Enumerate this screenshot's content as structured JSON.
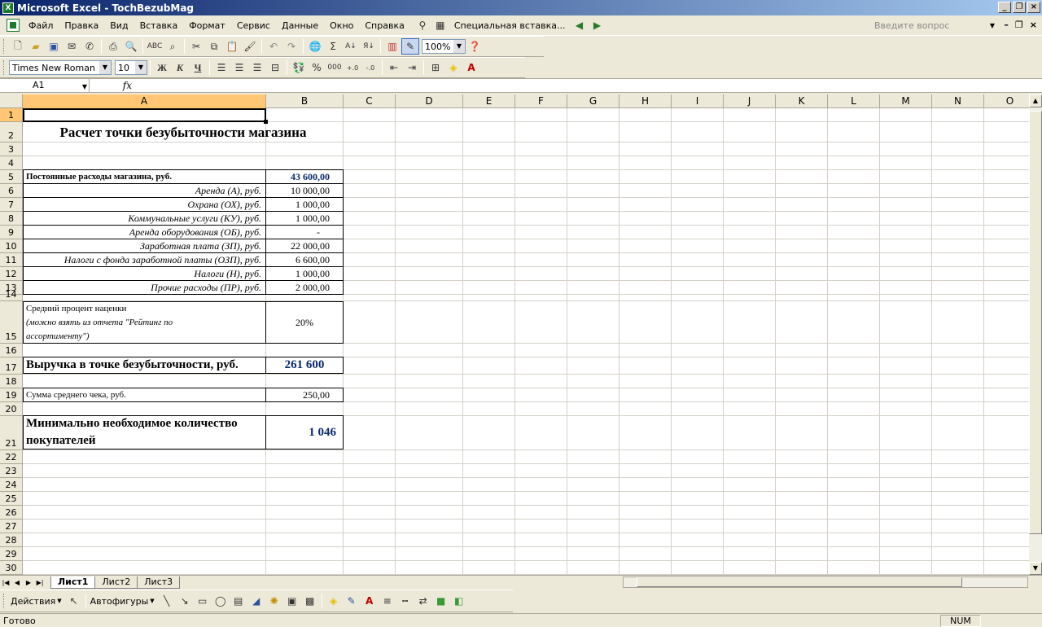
{
  "window": {
    "title": "Microsoft Excel - TochBezubMag"
  },
  "menu": {
    "items": [
      "Файл",
      "Правка",
      "Вид",
      "Вставка",
      "Формат",
      "Сервис",
      "Данные",
      "Окно",
      "Справка"
    ],
    "special_paste": "Специальная вставка...",
    "help_placeholder": "Введите вопрос"
  },
  "toolbar": {
    "zoom": "100%",
    "font_name": "Times New Roman",
    "font_size": "10",
    "bold": "Ж",
    "italic": "К",
    "underline": "Ч",
    "sum": "Σ",
    "percent": "%",
    "thousands": "000"
  },
  "formula_bar": {
    "name_box": "A1",
    "fx": "fx"
  },
  "columns": [
    "A",
    "B",
    "C",
    "D",
    "E",
    "F",
    "G",
    "H",
    "I",
    "J",
    "K",
    "L",
    "M",
    "N",
    "O"
  ],
  "rows": [
    "1",
    "2",
    "3",
    "4",
    "5",
    "6",
    "7",
    "8",
    "9",
    "10",
    "11",
    "12",
    "13",
    "14",
    "15",
    "16",
    "17",
    "18",
    "19",
    "20",
    "21",
    "22",
    "23",
    "24",
    "25",
    "26",
    "27",
    "28",
    "29",
    "30"
  ],
  "sheet": {
    "title": "Расчет точки безубыточности магазина",
    "fixed_costs_label": "Постоянные расходы магазина, руб.",
    "fixed_costs_value": "43 600,00",
    "cost_items": [
      {
        "label": "Аренда (А), руб.",
        "value": "10 000,00"
      },
      {
        "label": "Охрана (ОХ), руб.",
        "value": "1 000,00"
      },
      {
        "label": "Коммунальные услуги (КУ), руб.",
        "value": "1 000,00"
      },
      {
        "label": "Аренда оборудования (ОБ), руб.",
        "value": "-"
      },
      {
        "label": "Заработная плата (ЗП), руб.",
        "value": "22 000,00"
      },
      {
        "label": "Налоги с фонда заработной платы (ОЗП), руб.",
        "value": "6 600,00"
      },
      {
        "label": "Налоги (Н), руб.",
        "value": "1 000,00"
      },
      {
        "label": "Прочие расходы (ПР), руб.",
        "value": "2 000,00"
      }
    ],
    "markup_label_1": "Средний процент наценки",
    "markup_label_2": "(можно взять из отчета \"Рейтинг по",
    "markup_label_3": "ассортименту\")",
    "markup_value": "20%",
    "revenue_label": "Выручка в точке безубыточности, руб.",
    "revenue_value": "261 600",
    "avg_check_label": "Сумма среднего чека, руб.",
    "avg_check_value": "250,00",
    "min_buyers_label_1": "Минимально необходимое количество",
    "min_buyers_label_2": "покупателей",
    "min_buyers_value": "1 046"
  },
  "tabs": [
    "Лист1",
    "Лист2",
    "Лист3"
  ],
  "drawing": {
    "actions": "Действия",
    "autoshapes": "Автофигуры"
  },
  "status": {
    "ready": "Готово",
    "num": "NUM"
  },
  "colors": {
    "title_bar": "#0a246a",
    "selection_header": "#ffc773",
    "value_text": "#0a2a6e"
  }
}
